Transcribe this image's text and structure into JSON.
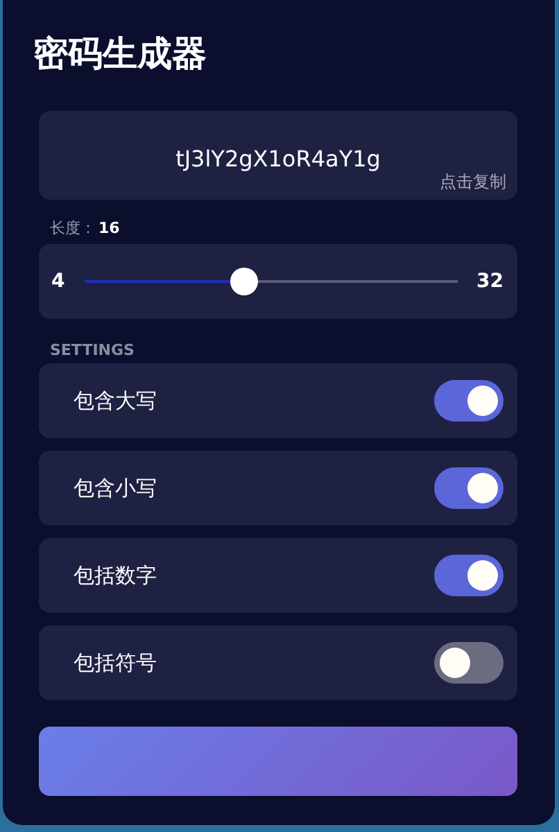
{
  "title": "密码生成器",
  "password": {
    "value": "tJ3lY2gX1oR4aY1g",
    "copy_hint": "点击复制"
  },
  "length": {
    "label": "长度：",
    "value": "16",
    "min": "4",
    "max": "32",
    "level": 0.43
  },
  "settings_heading": "SETTINGS",
  "settings": [
    {
      "label": "包含大写",
      "on": true
    },
    {
      "label": "包含小写",
      "on": true
    },
    {
      "label": "包括数字",
      "on": true
    },
    {
      "label": "包括符号",
      "on": false
    }
  ]
}
